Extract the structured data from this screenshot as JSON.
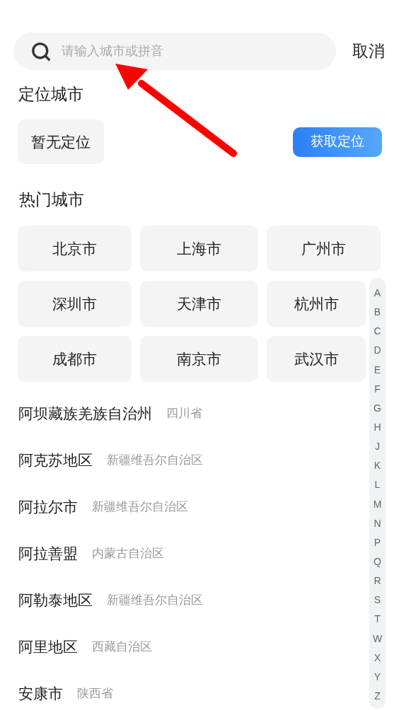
{
  "search": {
    "placeholder": "请输入城市或拼音",
    "cancel": "取消"
  },
  "location": {
    "title": "定位城市",
    "current": "暂无定位",
    "button": "获取定位"
  },
  "hot": {
    "title": "热门城市",
    "cities": [
      "北京市",
      "上海市",
      "广州市",
      "深圳市",
      "天津市",
      "杭州市",
      "成都市",
      "南京市",
      "武汉市"
    ]
  },
  "cities": [
    {
      "name": "阿坝藏族羌族自治州",
      "province": "四川省"
    },
    {
      "name": "阿克苏地区",
      "province": "新疆维吾尔自治区"
    },
    {
      "name": "阿拉尔市",
      "province": "新疆维吾尔自治区"
    },
    {
      "name": "阿拉善盟",
      "province": "内蒙古自治区"
    },
    {
      "name": "阿勒泰地区",
      "province": "新疆维吾尔自治区"
    },
    {
      "name": "阿里地区",
      "province": "西藏自治区"
    },
    {
      "name": "安康市",
      "province": "陕西省"
    }
  ],
  "index": [
    "A",
    "B",
    "C",
    "D",
    "E",
    "F",
    "G",
    "H",
    "J",
    "K",
    "L",
    "M",
    "N",
    "P",
    "Q",
    "R",
    "S",
    "T",
    "W",
    "X",
    "Y",
    "Z"
  ]
}
